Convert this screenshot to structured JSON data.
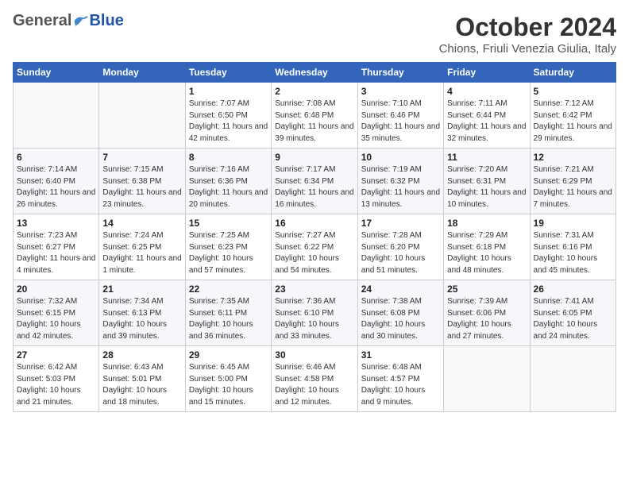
{
  "header": {
    "logo": {
      "general": "General",
      "blue": "Blue",
      "tagline": ""
    },
    "title": "October 2024",
    "location": "Chions, Friuli Venezia Giulia, Italy"
  },
  "columns": [
    "Sunday",
    "Monday",
    "Tuesday",
    "Wednesday",
    "Thursday",
    "Friday",
    "Saturday"
  ],
  "weeks": [
    [
      {
        "day": "",
        "detail": ""
      },
      {
        "day": "",
        "detail": ""
      },
      {
        "day": "1",
        "detail": "Sunrise: 7:07 AM\nSunset: 6:50 PM\nDaylight: 11 hours and 42 minutes."
      },
      {
        "day": "2",
        "detail": "Sunrise: 7:08 AM\nSunset: 6:48 PM\nDaylight: 11 hours and 39 minutes."
      },
      {
        "day": "3",
        "detail": "Sunrise: 7:10 AM\nSunset: 6:46 PM\nDaylight: 11 hours and 35 minutes."
      },
      {
        "day": "4",
        "detail": "Sunrise: 7:11 AM\nSunset: 6:44 PM\nDaylight: 11 hours and 32 minutes."
      },
      {
        "day": "5",
        "detail": "Sunrise: 7:12 AM\nSunset: 6:42 PM\nDaylight: 11 hours and 29 minutes."
      }
    ],
    [
      {
        "day": "6",
        "detail": "Sunrise: 7:14 AM\nSunset: 6:40 PM\nDaylight: 11 hours and 26 minutes."
      },
      {
        "day": "7",
        "detail": "Sunrise: 7:15 AM\nSunset: 6:38 PM\nDaylight: 11 hours and 23 minutes."
      },
      {
        "day": "8",
        "detail": "Sunrise: 7:16 AM\nSunset: 6:36 PM\nDaylight: 11 hours and 20 minutes."
      },
      {
        "day": "9",
        "detail": "Sunrise: 7:17 AM\nSunset: 6:34 PM\nDaylight: 11 hours and 16 minutes."
      },
      {
        "day": "10",
        "detail": "Sunrise: 7:19 AM\nSunset: 6:32 PM\nDaylight: 11 hours and 13 minutes."
      },
      {
        "day": "11",
        "detail": "Sunrise: 7:20 AM\nSunset: 6:31 PM\nDaylight: 11 hours and 10 minutes."
      },
      {
        "day": "12",
        "detail": "Sunrise: 7:21 AM\nSunset: 6:29 PM\nDaylight: 11 hours and 7 minutes."
      }
    ],
    [
      {
        "day": "13",
        "detail": "Sunrise: 7:23 AM\nSunset: 6:27 PM\nDaylight: 11 hours and 4 minutes."
      },
      {
        "day": "14",
        "detail": "Sunrise: 7:24 AM\nSunset: 6:25 PM\nDaylight: 11 hours and 1 minute."
      },
      {
        "day": "15",
        "detail": "Sunrise: 7:25 AM\nSunset: 6:23 PM\nDaylight: 10 hours and 57 minutes."
      },
      {
        "day": "16",
        "detail": "Sunrise: 7:27 AM\nSunset: 6:22 PM\nDaylight: 10 hours and 54 minutes."
      },
      {
        "day": "17",
        "detail": "Sunrise: 7:28 AM\nSunset: 6:20 PM\nDaylight: 10 hours and 51 minutes."
      },
      {
        "day": "18",
        "detail": "Sunrise: 7:29 AM\nSunset: 6:18 PM\nDaylight: 10 hours and 48 minutes."
      },
      {
        "day": "19",
        "detail": "Sunrise: 7:31 AM\nSunset: 6:16 PM\nDaylight: 10 hours and 45 minutes."
      }
    ],
    [
      {
        "day": "20",
        "detail": "Sunrise: 7:32 AM\nSunset: 6:15 PM\nDaylight: 10 hours and 42 minutes."
      },
      {
        "day": "21",
        "detail": "Sunrise: 7:34 AM\nSunset: 6:13 PM\nDaylight: 10 hours and 39 minutes."
      },
      {
        "day": "22",
        "detail": "Sunrise: 7:35 AM\nSunset: 6:11 PM\nDaylight: 10 hours and 36 minutes."
      },
      {
        "day": "23",
        "detail": "Sunrise: 7:36 AM\nSunset: 6:10 PM\nDaylight: 10 hours and 33 minutes."
      },
      {
        "day": "24",
        "detail": "Sunrise: 7:38 AM\nSunset: 6:08 PM\nDaylight: 10 hours and 30 minutes."
      },
      {
        "day": "25",
        "detail": "Sunrise: 7:39 AM\nSunset: 6:06 PM\nDaylight: 10 hours and 27 minutes."
      },
      {
        "day": "26",
        "detail": "Sunrise: 7:41 AM\nSunset: 6:05 PM\nDaylight: 10 hours and 24 minutes."
      }
    ],
    [
      {
        "day": "27",
        "detail": "Sunrise: 6:42 AM\nSunset: 5:03 PM\nDaylight: 10 hours and 21 minutes."
      },
      {
        "day": "28",
        "detail": "Sunrise: 6:43 AM\nSunset: 5:01 PM\nDaylight: 10 hours and 18 minutes."
      },
      {
        "day": "29",
        "detail": "Sunrise: 6:45 AM\nSunset: 5:00 PM\nDaylight: 10 hours and 15 minutes."
      },
      {
        "day": "30",
        "detail": "Sunrise: 6:46 AM\nSunset: 4:58 PM\nDaylight: 10 hours and 12 minutes."
      },
      {
        "day": "31",
        "detail": "Sunrise: 6:48 AM\nSunset: 4:57 PM\nDaylight: 10 hours and 9 minutes."
      },
      {
        "day": "",
        "detail": ""
      },
      {
        "day": "",
        "detail": ""
      }
    ]
  ]
}
